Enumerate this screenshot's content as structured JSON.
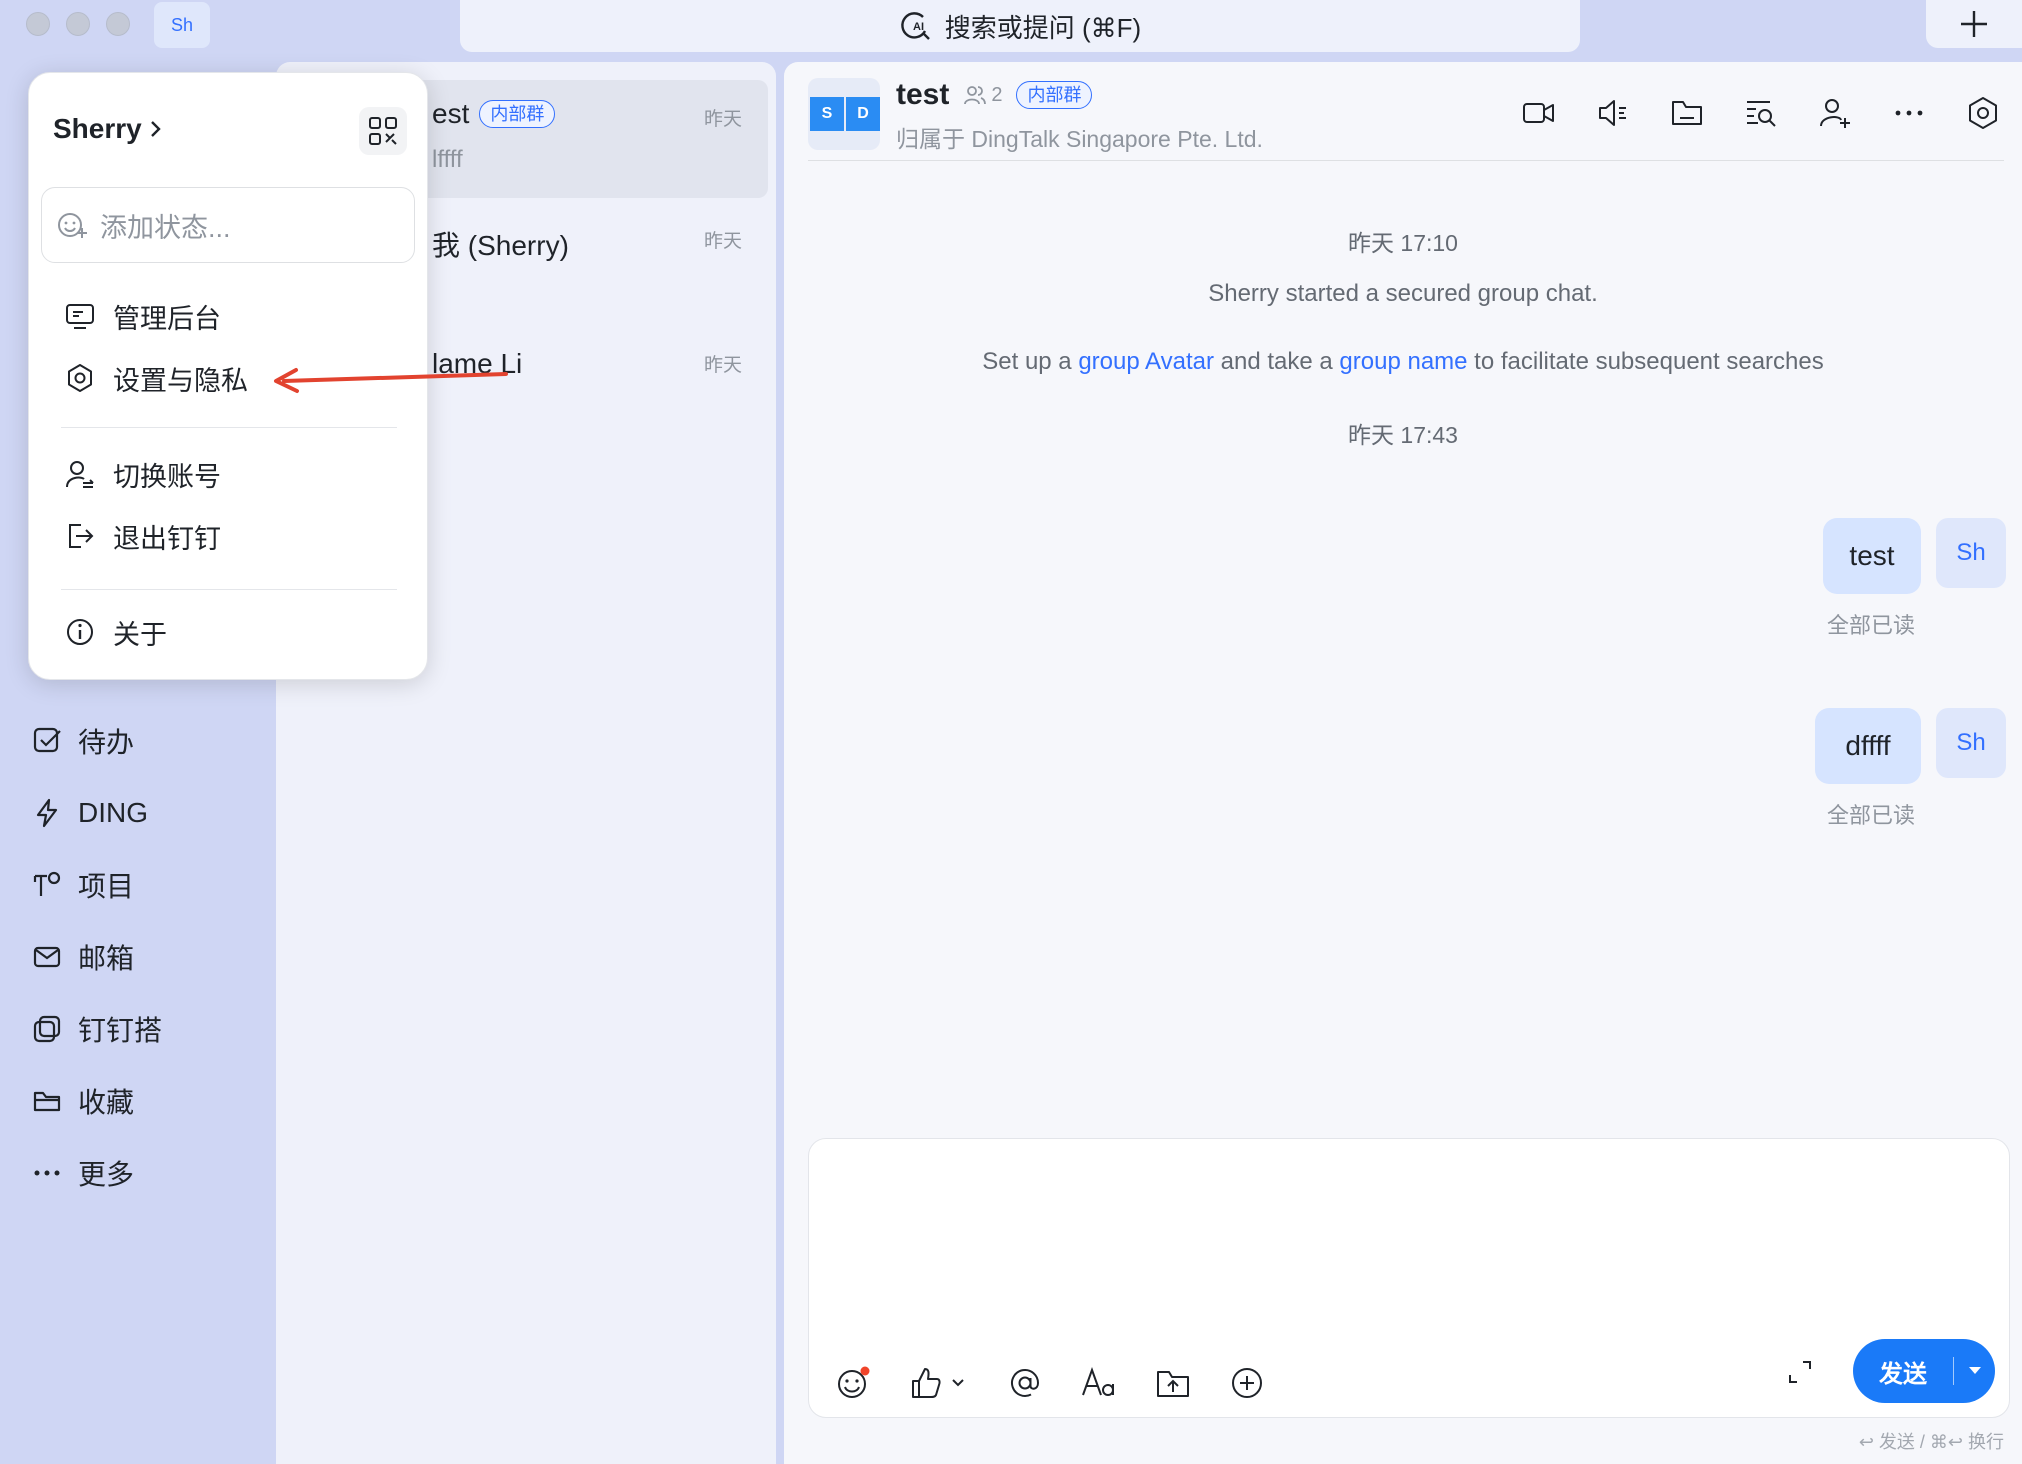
{
  "titlebar": {
    "avatar_text": "Sh",
    "search_label": "搜索或提问 (⌘F)",
    "search_icon": "ai-search-icon",
    "plus_icon": "plus-icon"
  },
  "sidebar": {
    "items": [
      {
        "label": "待办",
        "icon": "todo-check-icon"
      },
      {
        "label": "DING",
        "icon": "lightning-icon"
      },
      {
        "label": "项目",
        "icon": "project-icon"
      },
      {
        "label": "邮箱",
        "icon": "mail-icon"
      },
      {
        "label": "钉钉搭",
        "icon": "dingda-icon"
      },
      {
        "label": "收藏",
        "icon": "folder-icon"
      },
      {
        "label": "更多",
        "icon": "more-dots-icon"
      }
    ]
  },
  "conversations": [
    {
      "name": "est",
      "tag": "内部群",
      "preview": "lffff",
      "time": "昨天"
    },
    {
      "name": "我 (Sherry)",
      "time": "昨天"
    },
    {
      "name": "lame Li",
      "time": "昨天"
    }
  ],
  "chat": {
    "title": "test",
    "member_count": "2",
    "tag": "内部群",
    "org": "归属于 DingTalk Singapore Pte. Ltd.",
    "avatar_letters": [
      "S",
      "D"
    ],
    "header_icons": [
      "video-icon",
      "audio-icon",
      "file-icon",
      "search-history-icon",
      "add-member-icon",
      "more-icon",
      "settings-icon"
    ],
    "time1": "昨天 17:10",
    "sys1": "Sherry started a secured group chat.",
    "sys2": {
      "a": "Set up a ",
      "link1": "group Avatar",
      "b": " and take a ",
      "link2": "group name",
      "c": " to facilitate subsequent searches"
    },
    "time2": "昨天 17:43",
    "messages": [
      {
        "text": "test",
        "read": "全部已读",
        "avatar": "Sh"
      },
      {
        "text": "dffff",
        "read": "全部已读",
        "avatar": "Sh"
      }
    ],
    "send_label": "发送",
    "hint": "↩ 发送 / ⌘↩ 换行",
    "accent": "#3370ff"
  },
  "popup": {
    "user": "Sherry",
    "status_placeholder": "添加状态...",
    "menu": [
      {
        "label": "管理后台",
        "icon": "monitor-icon"
      },
      {
        "label": "设置与隐私",
        "icon": "gear-icon"
      },
      {
        "label": "切换账号",
        "icon": "switch-account-icon"
      },
      {
        "label": "退出钉钉",
        "icon": "logout-icon"
      },
      {
        "label": "关于",
        "icon": "info-icon"
      }
    ]
  },
  "annotation": {
    "arrow_color": "#e2432f"
  }
}
